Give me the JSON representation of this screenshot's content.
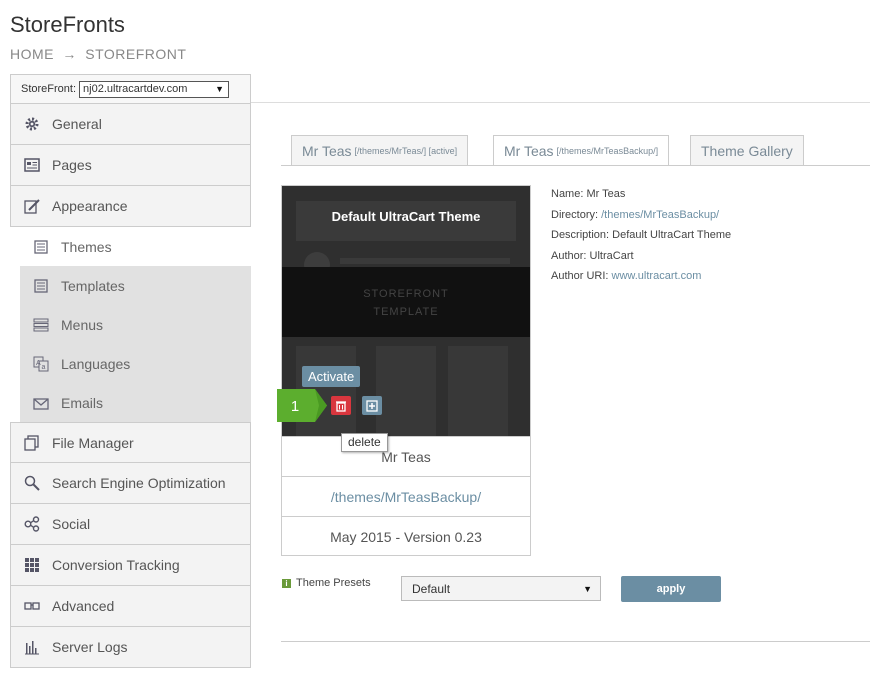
{
  "app": {
    "title": "StoreFronts"
  },
  "breadcrumb": {
    "home": "HOME",
    "arrow": "→",
    "current": "STOREFRONT"
  },
  "storefront_selector": {
    "label": "StoreFront:",
    "value": "nj02.ultracartdev.com"
  },
  "sidebar": {
    "items": [
      {
        "label": "General",
        "icon": "gear-icon"
      },
      {
        "label": "Pages",
        "icon": "pages-icon"
      },
      {
        "label": "Appearance",
        "icon": "brush-icon"
      }
    ],
    "subitems": [
      {
        "label": "Themes",
        "icon": "themes-icon",
        "active": true
      },
      {
        "label": "Templates",
        "icon": "templates-icon"
      },
      {
        "label": "Menus",
        "icon": "menu-icon"
      },
      {
        "label": "Languages",
        "icon": "languages-icon"
      },
      {
        "label": "Emails",
        "icon": "envelope-icon"
      }
    ],
    "items_after": [
      {
        "label": "File Manager",
        "icon": "file-icon"
      },
      {
        "label": "Search Engine Optimization",
        "icon": "search-icon"
      },
      {
        "label": "Social",
        "icon": "share-icon"
      },
      {
        "label": "Conversion Tracking",
        "icon": "grid-icon"
      },
      {
        "label": "Advanced",
        "icon": "glasses-icon"
      },
      {
        "label": "Server Logs",
        "icon": "bar-chart-icon"
      }
    ]
  },
  "tabs": [
    {
      "name": "Mr Teas",
      "path": "[/themes/MrTeas/] [active]"
    },
    {
      "name": "Mr Teas",
      "path": "[/themes/MrTeasBackup/]",
      "active": true
    },
    {
      "name": "Theme Gallery",
      "path": ""
    }
  ],
  "theme_card": {
    "preview_title": "Default UltraCart Theme",
    "preview_band_line1": "STOREFRONT",
    "preview_band_line2": "TEMPLATE",
    "activate_label": "Activate",
    "name": "Mr Teas",
    "directory": "/themes/MrTeasBackup/",
    "version": "May 2015 - Version 0.23"
  },
  "callout": {
    "number": "1",
    "color": "#5cae2e"
  },
  "tooltip": {
    "text": "delete"
  },
  "theme_info": {
    "name_label": "Name:",
    "name": "Mr Teas",
    "directory_label": "Directory:",
    "directory": "/themes/MrTeasBackup/",
    "description_label": "Description:",
    "description": "Default UltraCart Theme",
    "author_label": "Author:",
    "author": "UltraCart",
    "author_uri_label": "Author URI:",
    "author_uri": "www.ultracart.com"
  },
  "presets": {
    "label": "Theme Presets",
    "value": "Default",
    "apply_label": "apply"
  },
  "colors": {
    "accent": "#6b8ea3",
    "delete": "#d9363e",
    "callout": "#5cae2e"
  }
}
